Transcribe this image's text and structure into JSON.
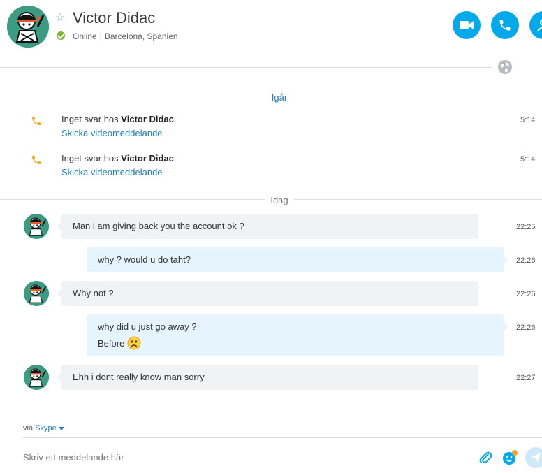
{
  "header": {
    "contact_name": "Victor Didac",
    "status": "Online",
    "location": "Barcelona, Spanien",
    "buttons": [
      {
        "name": "video-call",
        "icon": "video-camera-icon"
      },
      {
        "name": "audio-call",
        "icon": "phone-icon"
      },
      {
        "name": "add-contact",
        "icon": "add-person-icon"
      }
    ],
    "favorite_icon": "star-outline-icon",
    "presence_icon": "online-check-icon",
    "globe_icon": "globe-icon"
  },
  "colors": {
    "accent": "#00a9ec",
    "link": "#1d7fbf",
    "online": "#7cb82f",
    "incoming_bubble": "#f1f2f4",
    "outgoing_bubble": "#e5f4fd",
    "call_icon": "#f7a21b"
  },
  "days": {
    "yesterday": "Igår",
    "today": "Idag"
  },
  "call_events": [
    {
      "prefix": "Inget svar hos ",
      "name": "Victor Didac",
      "suffix": ".",
      "link": "Skicka videomeddelande",
      "time": "5:14"
    },
    {
      "prefix": "Inget svar hos ",
      "name": "Victor Didac",
      "suffix": ".",
      "link": "Skicka videomeddelande",
      "time": "5:14"
    }
  ],
  "messages": [
    {
      "direction": "in",
      "text": "Man i am giving back you the account ok  ?",
      "time": "22:25"
    },
    {
      "direction": "out",
      "text": "why ? would u do taht?",
      "time": "22:26"
    },
    {
      "direction": "in",
      "text": "Why not ?",
      "time": "22:26"
    },
    {
      "direction": "out",
      "text": "why did u just go away ?",
      "text2": "Before",
      "emoji": "sad-face-icon",
      "time": "22:26"
    },
    {
      "direction": "in",
      "text": "Ehh i dont really know man sorry",
      "time": "22:27"
    }
  ],
  "footer": {
    "via_prefix": "via",
    "via_service": "Skype",
    "compose_placeholder": "Skriv ett meddelande här",
    "attach_icon": "paperclip-icon",
    "emoji_icon": "emoticon-icon",
    "send_icon": "send-icon"
  }
}
